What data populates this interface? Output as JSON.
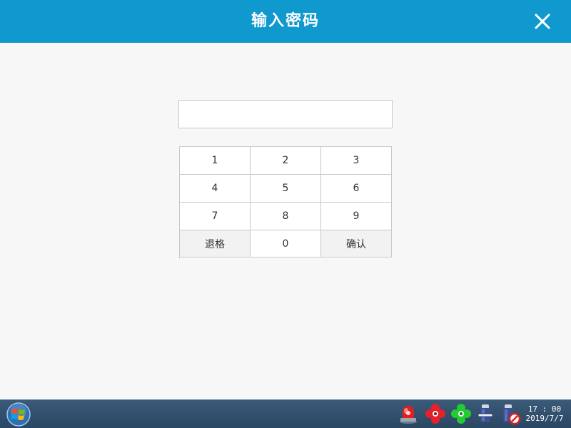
{
  "dialog": {
    "title": "输入密码",
    "close_icon": "close-icon"
  },
  "password": {
    "value": "",
    "placeholder": ""
  },
  "keypad": {
    "keys": [
      "1",
      "2",
      "3",
      "4",
      "5",
      "6",
      "7",
      "8",
      "9",
      "退格",
      "0",
      "确认"
    ]
  },
  "taskbar": {
    "start_icon": "windows-start-icon",
    "tray_icons": [
      "alarm-light-icon",
      "red-fan-icon",
      "green-fan-icon",
      "cylinder-icon",
      "cylinder-disabled-icon"
    ],
    "clock_time": "17 : 00",
    "clock_date": "2019/7/7"
  },
  "colors": {
    "titlebar": "#0f99cf",
    "background": "#f7f7f7",
    "taskbar": "#2f4d6a",
    "key_border": "#c8c8c8",
    "alarm_red": "#e02020",
    "fan_red": "#e8202a",
    "fan_green": "#22cc33"
  }
}
